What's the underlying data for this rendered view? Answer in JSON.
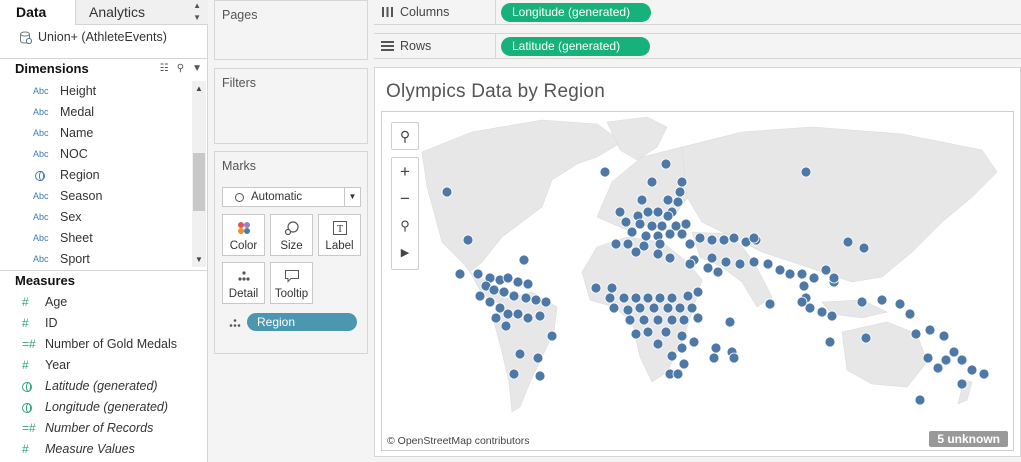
{
  "tabs": {
    "data": "Data",
    "analytics": "Analytics"
  },
  "datasource": "Union+ (AthleteEvents)",
  "dimensions": {
    "title": "Dimensions",
    "items": [
      {
        "type": "Abc",
        "label": "Height"
      },
      {
        "type": "Abc",
        "label": "Medal"
      },
      {
        "type": "Abc",
        "label": "Name"
      },
      {
        "type": "Abc",
        "label": "NOC"
      },
      {
        "type": "globe",
        "label": "Region"
      },
      {
        "type": "Abc",
        "label": "Season"
      },
      {
        "type": "Abc",
        "label": "Sex"
      },
      {
        "type": "Abc",
        "label": "Sheet"
      },
      {
        "type": "Abc",
        "label": "Sport"
      }
    ]
  },
  "measures": {
    "title": "Measures",
    "items": [
      {
        "type": "#",
        "label": "Age",
        "italic": false
      },
      {
        "type": "#",
        "label": "ID",
        "italic": false
      },
      {
        "type": "=#",
        "label": "Number of Gold Medals",
        "italic": false
      },
      {
        "type": "#",
        "label": "Year",
        "italic": false
      },
      {
        "type": "globe",
        "label": "Latitude (generated)",
        "italic": true
      },
      {
        "type": "globe",
        "label": "Longitude (generated)",
        "italic": true
      },
      {
        "type": "=#",
        "label": "Number of Records",
        "italic": true
      },
      {
        "type": "#",
        "label": "Measure Values",
        "italic": true
      }
    ]
  },
  "shelves": {
    "pages": "Pages",
    "filters": "Filters",
    "marks": "Marks",
    "columns_label": "Columns",
    "rows_label": "Rows",
    "columns_pill": "Longitude (generated)",
    "rows_pill": "Latitude (generated)"
  },
  "marks": {
    "type": "Automatic",
    "buttons": {
      "color": "Color",
      "size": "Size",
      "label": "Label",
      "detail": "Detail",
      "tooltip": "Tooltip"
    },
    "detail_pill": "Region"
  },
  "view": {
    "title": "Olympics Data by Region",
    "attribution": "© OpenStreetMap contributors",
    "unknown": "5 unknown",
    "mark_color": "#4e79a7"
  }
}
